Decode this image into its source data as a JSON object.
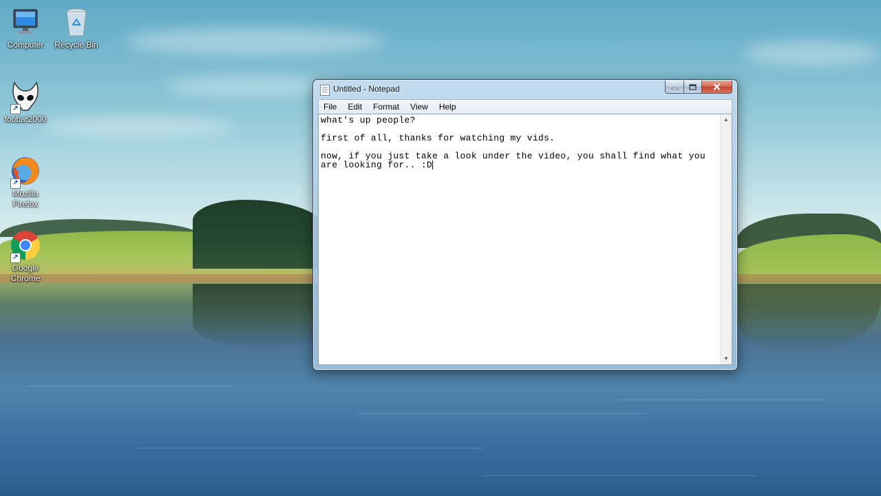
{
  "desktop": {
    "icons": [
      {
        "label": "Computer",
        "icon": "computer-icon"
      },
      {
        "label": "Recycle Bin",
        "icon": "recycle-bin-icon"
      },
      {
        "label": "foobar2000",
        "icon": "foobar2000-icon"
      },
      {
        "label": "Mozilla Firefox",
        "icon": "firefox-icon"
      },
      {
        "label": "Google Chrome",
        "icon": "chrome-icon"
      }
    ]
  },
  "notepad": {
    "title": "Untitled - Notepad",
    "menu": [
      "File",
      "Edit",
      "Format",
      "View",
      "Help"
    ],
    "content": {
      "line1": "what's up people?",
      "line2": "first of all, thanks for watching my vids.",
      "line3": "now, if you just take a look under the video, you shall find what you\nare looking for.. :D"
    },
    "caption_buttons": {
      "minimize": "minimize-icon",
      "maximize": "maximize-icon",
      "close": "close-icon"
    }
  }
}
